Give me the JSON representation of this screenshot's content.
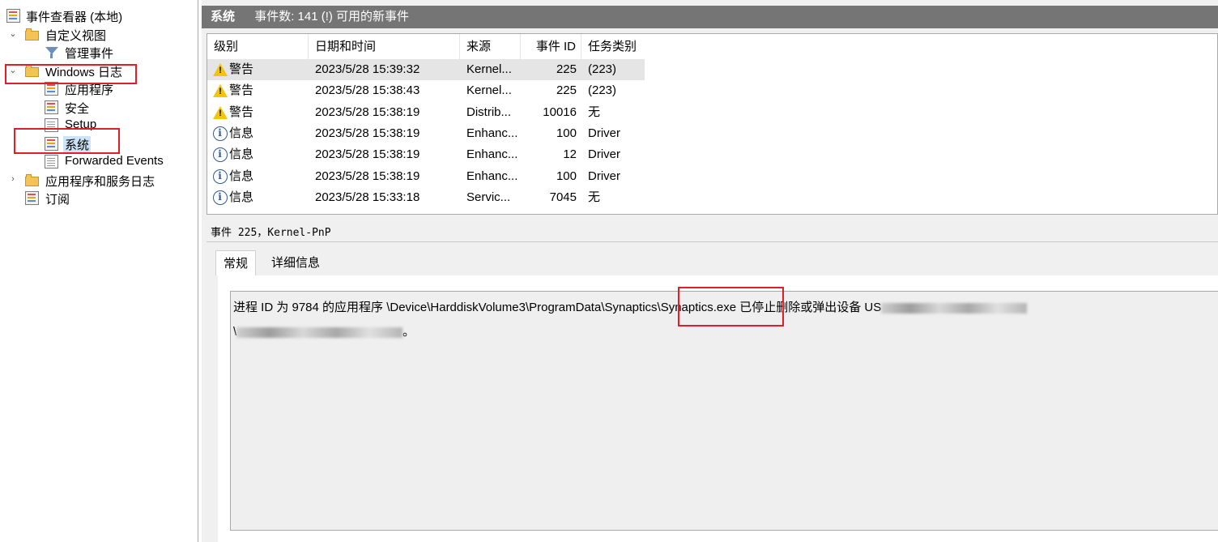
{
  "tree": {
    "root_label": "事件查看器 (本地)",
    "custom_views": "自定义视图",
    "admin_events": "管理事件",
    "windows_logs": "Windows 日志",
    "application": "应用程序",
    "security": "安全",
    "setup": "Setup",
    "system": "系统",
    "forwarded": "Forwarded Events",
    "apps_services": "应用程序和服务日志",
    "subscriptions": "订阅"
  },
  "header": {
    "title": "系统",
    "count_text": "事件数: 141 (!) 可用的新事件"
  },
  "columns": [
    "级别",
    "日期和时间",
    "来源",
    "事件 ID",
    "任务类别"
  ],
  "events": [
    {
      "level": "警告",
      "icon": "warning-icon",
      "datetime": "2023/5/28 15:39:32",
      "source": "Kernel...",
      "id": "225",
      "task": "(223)"
    },
    {
      "level": "警告",
      "icon": "warning-icon",
      "datetime": "2023/5/28 15:38:43",
      "source": "Kernel...",
      "id": "225",
      "task": "(223)"
    },
    {
      "level": "警告",
      "icon": "warning-icon",
      "datetime": "2023/5/28 15:38:19",
      "source": "Distrib...",
      "id": "10016",
      "task": "无"
    },
    {
      "level": "信息",
      "icon": "info-icon",
      "datetime": "2023/5/28 15:38:19",
      "source": "Enhanc...",
      "id": "100",
      "task": "Driver"
    },
    {
      "level": "信息",
      "icon": "info-icon",
      "datetime": "2023/5/28 15:38:19",
      "source": "Enhanc...",
      "id": "12",
      "task": "Driver"
    },
    {
      "level": "信息",
      "icon": "info-icon",
      "datetime": "2023/5/28 15:38:19",
      "source": "Enhanc...",
      "id": "100",
      "task": "Driver"
    },
    {
      "level": "信息",
      "icon": "info-icon",
      "datetime": "2023/5/28 15:33:18",
      "source": "Servic...",
      "id": "7045",
      "task": "无"
    }
  ],
  "detail": {
    "title": "事件 225，Kernel-PnP",
    "tab_general": "常规",
    "tab_details": "详细信息",
    "message_line1": "进程 ID 为 9784 的应用程序 \\Device\\HarddiskVolume3\\ProgramData\\Synaptics\\Synaptics.exe 已停止删除或弹出设备 US",
    "message_line2_prefix": "\\",
    "message_line2_suffix": "。"
  }
}
